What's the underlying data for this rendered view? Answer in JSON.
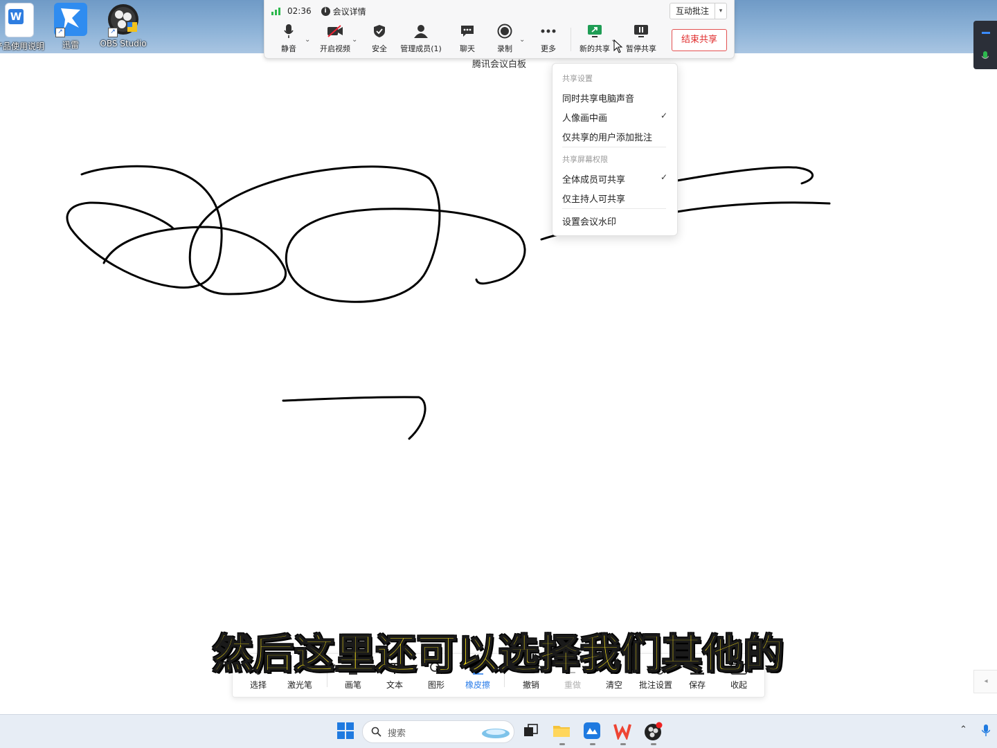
{
  "desktop": {
    "icons": [
      {
        "label": "产品使用说明",
        "icon": "wps-writer-icon"
      },
      {
        "label": "迅雷",
        "icon": "thunder-icon"
      },
      {
        "label": "OBS Studio",
        "icon": "obs-icon"
      }
    ]
  },
  "meeting_bar": {
    "timer": "02:36",
    "meeting_details": "会议详情",
    "annotate_button": "互动批注",
    "tools": [
      {
        "label": "静音",
        "icon": "microphone-icon"
      },
      {
        "label": "开启视频",
        "icon": "video-off-icon"
      },
      {
        "label": "安全",
        "icon": "shield-icon"
      },
      {
        "label": "管理成员(1)",
        "icon": "members-icon"
      },
      {
        "label": "聊天",
        "icon": "chat-icon"
      },
      {
        "label": "录制",
        "icon": "record-icon"
      },
      {
        "label": "更多",
        "icon": "more-icon"
      },
      {
        "label": "新的共享",
        "icon": "new-share-icon"
      },
      {
        "label": "暂停共享",
        "icon": "pause-share-icon"
      }
    ],
    "end_share": "结束共享",
    "accent_color": "#e02e2e"
  },
  "board_title": "腾讯会议白板",
  "share_menu": {
    "section1": "共享设置",
    "items1": [
      {
        "label": "同时共享电脑声音",
        "checked": false
      },
      {
        "label": "人像画中画",
        "checked": true
      },
      {
        "label": "仅共享的用户添加批注",
        "checked": false
      }
    ],
    "section2": "共享屏幕权限",
    "items2": [
      {
        "label": "全体成员可共享",
        "checked": true
      },
      {
        "label": "仅主持人可共享",
        "checked": false
      }
    ],
    "items3": [
      {
        "label": "设置会议水印",
        "checked": false
      }
    ],
    "check_mark": "✓"
  },
  "whiteboard_bar": {
    "tools": [
      {
        "label": "选择",
        "icon": "select-icon"
      },
      {
        "label": "激光笔",
        "icon": "laser-pointer-icon"
      },
      {
        "label": "画笔",
        "icon": "pen-icon"
      },
      {
        "label": "文本",
        "icon": "text-icon"
      },
      {
        "label": "图形",
        "icon": "shapes-icon"
      },
      {
        "label": "橡皮擦",
        "icon": "eraser-icon",
        "active": true
      },
      {
        "label": "撤销",
        "icon": "undo-icon"
      },
      {
        "label": "重做",
        "icon": "redo-icon",
        "disabled": true
      },
      {
        "label": "清空",
        "icon": "clear-icon"
      },
      {
        "label": "批注设置",
        "icon": "annotation-settings-icon"
      },
      {
        "label": "保存",
        "icon": "save-icon"
      },
      {
        "label": "收起",
        "icon": "collapse-icon"
      }
    ],
    "active_color": "#2b7de9"
  },
  "subtitle": "然后这里还可以选择我们其他的",
  "taskbar": {
    "search_placeholder": "搜索",
    "apps": [
      "windows-start-icon",
      "task-view-icon",
      "file-explorer-icon",
      "app-icon",
      "wps-icon",
      "obs-icon"
    ]
  }
}
